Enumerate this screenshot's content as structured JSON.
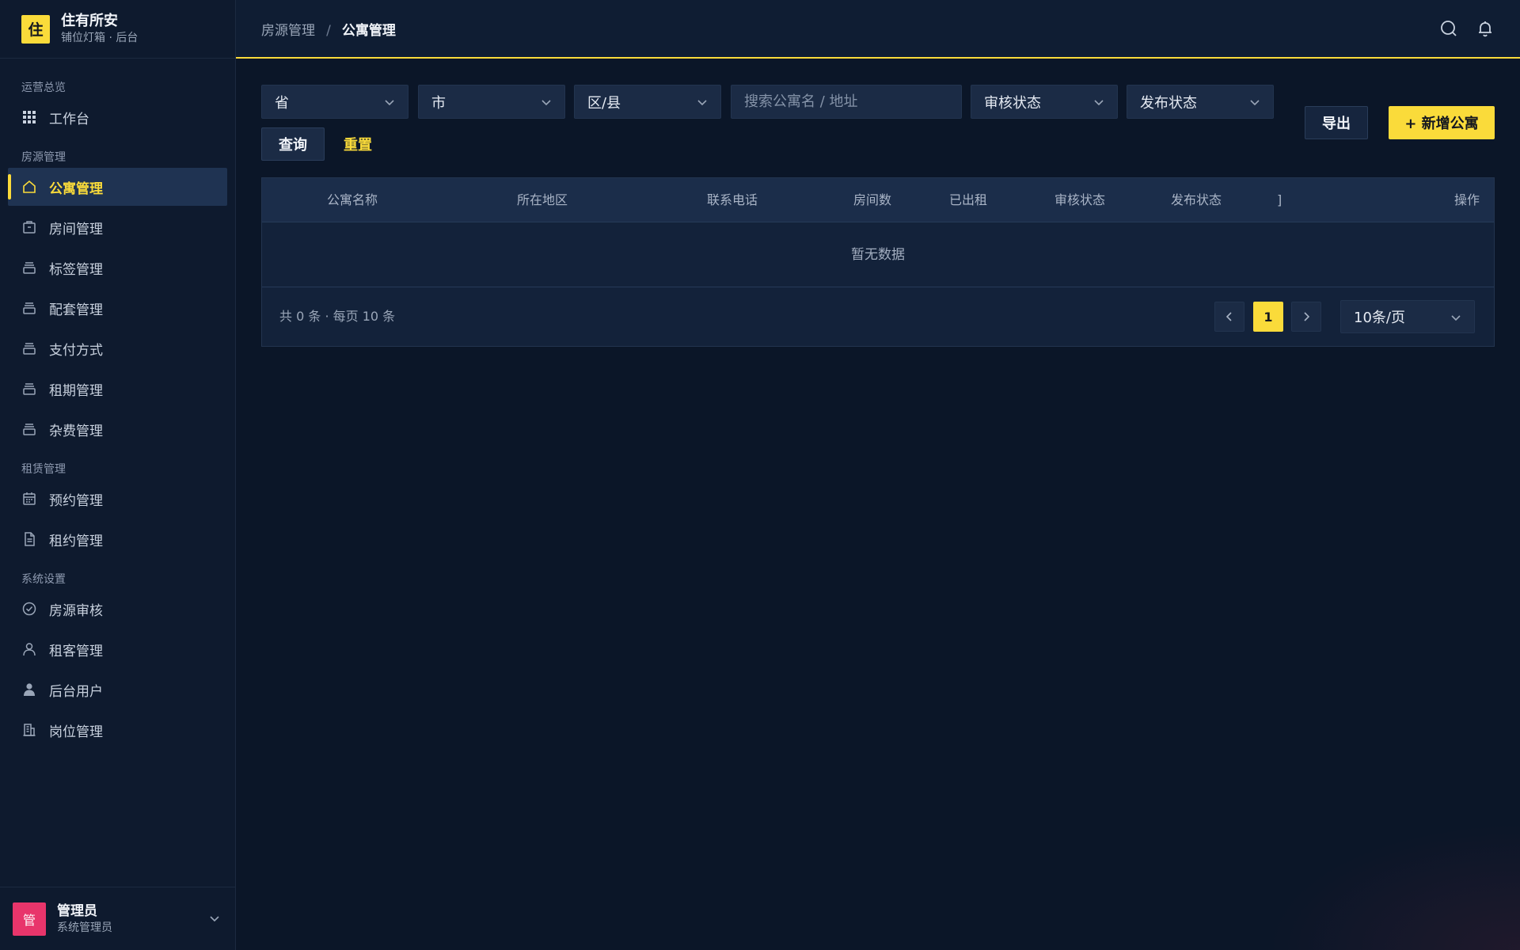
{
  "brand": {
    "logo_char": "住",
    "name": "住有所安",
    "subtitle": "铺位灯箱 · 后台"
  },
  "sidebar": {
    "groups": [
      {
        "label": "运营总览",
        "items": [
          {
            "label": "工作台",
            "icon": "grid-icon"
          }
        ]
      },
      {
        "label": "房源管理",
        "items": [
          {
            "label": "公寓管理",
            "icon": "home-icon",
            "active": true
          },
          {
            "label": "房间管理",
            "icon": "box-icon"
          },
          {
            "label": "标签管理",
            "icon": "stack-icon"
          },
          {
            "label": "配套管理",
            "icon": "stack-icon"
          },
          {
            "label": "支付方式",
            "icon": "stack-icon"
          },
          {
            "label": "租期管理",
            "icon": "stack-icon"
          },
          {
            "label": "杂费管理",
            "icon": "stack-icon"
          }
        ]
      },
      {
        "label": "租赁管理",
        "items": [
          {
            "label": "预约管理",
            "icon": "calendar-icon"
          },
          {
            "label": "租约管理",
            "icon": "document-icon"
          }
        ]
      },
      {
        "label": "系统设置",
        "items": [
          {
            "label": "房源审核",
            "icon": "check-circle-icon"
          },
          {
            "label": "租客管理",
            "icon": "user-outline-icon"
          },
          {
            "label": "后台用户",
            "icon": "user-solid-icon"
          },
          {
            "label": "岗位管理",
            "icon": "building-icon"
          }
        ]
      }
    ]
  },
  "user": {
    "avatar_char": "管",
    "name": "管理员",
    "role": "系统管理员"
  },
  "topbar": {
    "crumb_parent": "房源管理",
    "crumb_sep": "/",
    "crumb_current": "公寓管理"
  },
  "filters": {
    "province": "省",
    "city": "市",
    "district": "区/县",
    "search_placeholder": "搜索公寓名 / 地址",
    "review_status": "审核状态",
    "publish_status": "发布状态"
  },
  "actions": {
    "query": "查询",
    "reset": "重置",
    "export": "导出",
    "add": "+ 新增公寓"
  },
  "table": {
    "columns": [
      "公寓名称",
      "所在地区",
      "联系电话",
      "房间数",
      "已出租",
      "审核状态",
      "发布状态",
      "]",
      "操作"
    ],
    "empty_text": "暂无数据"
  },
  "pagination": {
    "summary": "共 0 条 · 每页 10 条",
    "current_page": "1",
    "page_size": "10条/页"
  },
  "colors": {
    "accent": "#fadb3a",
    "background": "#0b1628",
    "panel": "#13223a",
    "avatar": "#e8356b"
  }
}
